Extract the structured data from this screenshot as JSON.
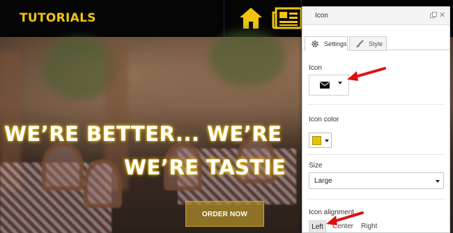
{
  "site": {
    "brand": "TUTORIALS",
    "headline_line1": "WE’RE BETTER... WE’RE",
    "headline_line2": "WE’RE TASTIE",
    "cta_label": "ORDER NOW",
    "nav_icons": [
      "home-icon",
      "newspaper-icon"
    ],
    "accent_color": "#f1c40f"
  },
  "panel": {
    "title": "Icon",
    "tabs": [
      {
        "label": "Settings",
        "icon": "gear-icon",
        "active": true
      },
      {
        "label": "Style",
        "icon": "brush-icon",
        "active": false
      }
    ],
    "icon_section": {
      "label": "Icon",
      "selected_icon": "envelope-icon"
    },
    "icon_color_section": {
      "label": "Icon color",
      "value": "#e6c300"
    },
    "size_section": {
      "label": "Size",
      "value": "Large"
    },
    "alignment_section": {
      "label": "Icon alignment",
      "options": [
        "Left",
        "Center",
        "Right"
      ],
      "selected": "Left"
    }
  }
}
